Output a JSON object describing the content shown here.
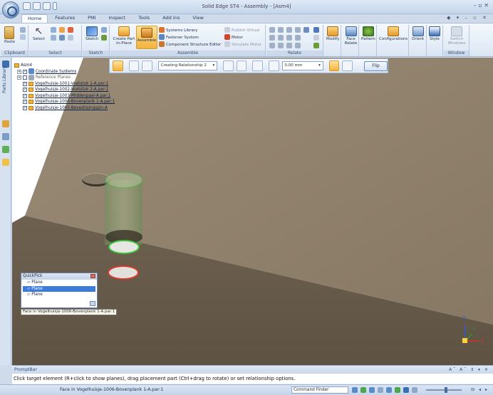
{
  "window": {
    "title": "Solid Edge ST4 - Assembly - [Asm4]",
    "controls": "–  ▫  ✕"
  },
  "tabs": [
    "Home",
    "Features",
    "PMI",
    "Inspect",
    "Tools",
    "Add Ins",
    "View"
  ],
  "active_tab": "Home",
  "help_icons": "◆ ▾  –  ▫  ✕",
  "ribbon": {
    "clipboard": {
      "label": "Clipboard",
      "paste": "Paste"
    },
    "select": {
      "label": "Select",
      "select": "Select"
    },
    "sketch": {
      "label": "Sketch",
      "sketch": "Sketch"
    },
    "assemble": {
      "label": "Assemble",
      "create_part_in_place": "Create Part In-Place",
      "assemble": "Assemble",
      "systems_library": "Systems Library",
      "fastener_system": "Fastener System",
      "component_structure_editor": "Component Structure Editor",
      "publish_virtual": "Publish Virtual",
      "motor": "Motor",
      "simulate_motor": "Simulate Motor"
    },
    "relate": {
      "label": "Relate"
    },
    "modify": "Modify",
    "face_relate": "Face Relate",
    "pattern": "Pattern",
    "configurations": "Configurations",
    "orient": "Orient",
    "style": "Style",
    "window": {
      "label": "Window",
      "switch_windows": "Switch Windows"
    }
  },
  "left_strip": {
    "label": "Parts Library"
  },
  "command_bar": {
    "relationship_combo": "Creating Relationship 2",
    "offset_value": "0,00 mm",
    "flip": "Flip"
  },
  "tree": {
    "root": "Asm4",
    "items": [
      {
        "label": "Coordinate Systems",
        "underline": true
      },
      {
        "label": "Reference Planes",
        "underline": false
      },
      {
        "label": "Vogelhuisje-1001-Voetstuk 1-A.par:1",
        "underline": true
      },
      {
        "label": "Vogelhuisje-1002-Voetstuk 2-A.par:1",
        "underline": true
      },
      {
        "label": "Vogelhuisje-1003-Middenpaal-A.par:1",
        "underline": true
      },
      {
        "label": "Vogelhuisje-1006-Bovenplank 1-A.par:1",
        "underline": true
      },
      {
        "label": "Vogelhuisje-1005-Bevestigingspin-A",
        "underline": true
      }
    ]
  },
  "quickpick": {
    "title": "QuickPick",
    "items": [
      "Plane",
      "Plane",
      "Plane"
    ],
    "selected_index": 1,
    "tooltip": "Face in Vogelhuisje-1006-Bovenplank 1-A.par:1"
  },
  "prompt_bar": {
    "title": "PromptBar",
    "controls": "A˜ A˜ ⇕ ▾ ✕",
    "text": "Click target element (R+click to show planes), drag placement part (Ctrl+drag to rotate) or set relationship options."
  },
  "status_bar": {
    "text": "Face in Vogelhuisje-1006-Bovenplank 1-A.par:1",
    "command_finder_placeholder": "Command Finder",
    "right_controls": "⊟ ◂ ▸"
  },
  "triad": {
    "x": "X",
    "y": "Y",
    "z": "Z"
  },
  "colors": {
    "accent": "#f4b23c",
    "selection": "#3e7bd6",
    "board": "#8d7d68",
    "highlight_green": "#39c239",
    "highlight_red": "#d93a2b"
  }
}
